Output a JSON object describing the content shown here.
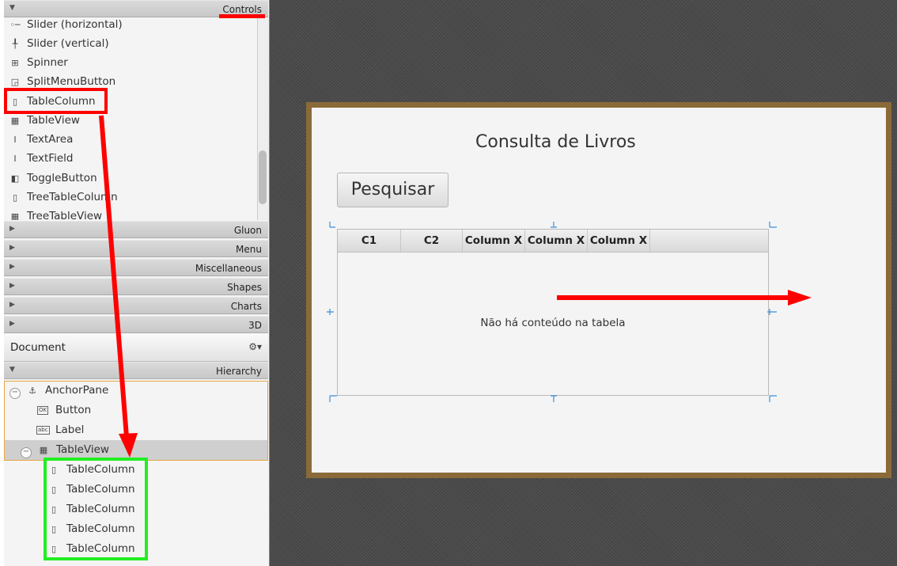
{
  "controls_panel": {
    "title": "Controls",
    "items": [
      {
        "label": "Slider  (horizontal)",
        "icon": "slider-horizontal-icon"
      },
      {
        "label": "Slider  (vertical)",
        "icon": "slider-vertical-icon"
      },
      {
        "label": "Spinner",
        "icon": "spinner-icon"
      },
      {
        "label": "SplitMenuButton",
        "icon": "split-menu-button-icon"
      },
      {
        "label": "TableColumn",
        "icon": "table-column-icon"
      },
      {
        "label": "TableView",
        "icon": "table-view-icon"
      },
      {
        "label": "TextArea",
        "icon": "text-area-icon"
      },
      {
        "label": "TextField",
        "icon": "text-field-icon"
      },
      {
        "label": "ToggleButton",
        "icon": "toggle-button-icon"
      },
      {
        "label": "TreeTableColumn",
        "icon": "tree-table-column-icon"
      },
      {
        "label": "TreeTableView",
        "icon": "tree-table-view-icon"
      }
    ]
  },
  "library_sections": [
    "Gluon",
    "Menu",
    "Miscellaneous",
    "Shapes",
    "Charts",
    "3D"
  ],
  "document_panel": {
    "title": "Document",
    "gear_icon": "gear-icon",
    "hierarchy_title": "Hierarchy",
    "tree": [
      {
        "label": "AnchorPane",
        "icon": "anchor-icon"
      },
      {
        "label": "Button",
        "icon": "button-icon",
        "icon_text": "OK"
      },
      {
        "label": "Label",
        "icon": "label-icon",
        "icon_text": "abc"
      },
      {
        "label": "TableView",
        "icon": "table-view-icon"
      },
      {
        "label": "TableColumn",
        "icon": "table-column-icon"
      },
      {
        "label": "TableColumn",
        "icon": "table-column-icon"
      },
      {
        "label": "TableColumn",
        "icon": "table-column-icon"
      },
      {
        "label": "TableColumn",
        "icon": "table-column-icon"
      },
      {
        "label": "TableColumn",
        "icon": "table-column-icon"
      }
    ]
  },
  "canvas": {
    "title": "Consulta de Livros",
    "button_label": "Pesquisar",
    "table": {
      "columns": [
        "C1",
        "C2",
        "Column X",
        "Column X",
        "Column X"
      ],
      "empty_text": "Não há conteúdo na tabela"
    }
  },
  "annotations": {
    "red_color": "#ff0000",
    "green_color": "#22ee22"
  }
}
